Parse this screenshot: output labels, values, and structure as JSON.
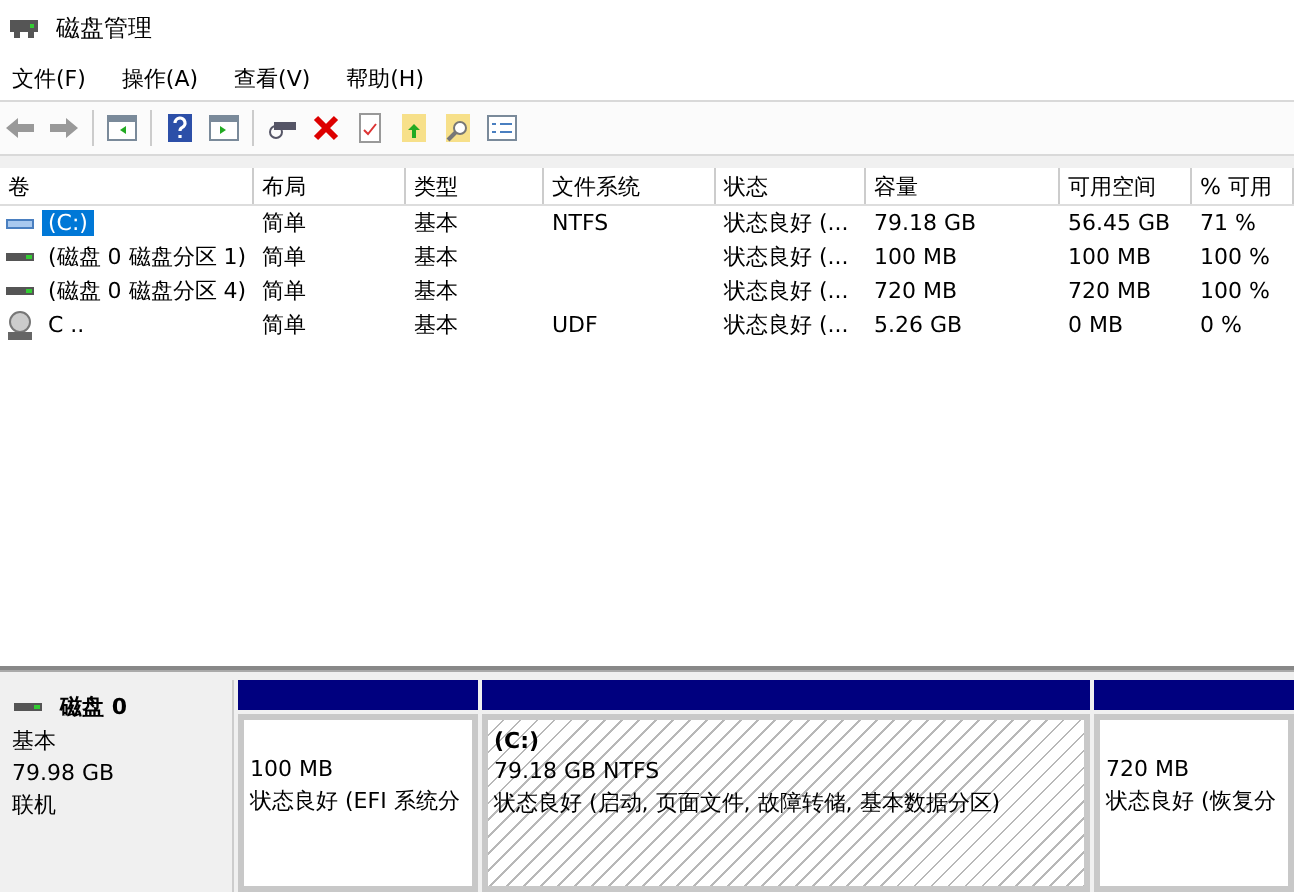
{
  "window": {
    "title": "磁盘管理"
  },
  "menu": [
    "文件(F)",
    "操作(A)",
    "查看(V)",
    "帮助(H)"
  ],
  "table": {
    "columns": [
      "卷",
      "布局",
      "类型",
      "文件系统",
      "状态",
      "容量",
      "可用空间",
      "% 可用"
    ],
    "rows": [
      {
        "kind": "disk",
        "selected": true,
        "cells": [
          "(C:)",
          "简单",
          "基本",
          "NTFS",
          "状态良好 (...",
          "79.18 GB",
          "56.45 GB",
          "71 %"
        ]
      },
      {
        "kind": "partition",
        "selected": false,
        "cells": [
          "(磁盘 0 磁盘分区 1)",
          "简单",
          "基本",
          "",
          "状态良好 (...",
          "100 MB",
          "100 MB",
          "100 %"
        ]
      },
      {
        "kind": "partition",
        "selected": false,
        "cells": [
          "(磁盘 0 磁盘分区 4)",
          "简单",
          "基本",
          "",
          "状态良好 (...",
          "720 MB",
          "720 MB",
          "100 %"
        ]
      },
      {
        "kind": "cdrom",
        "selected": false,
        "cells": [
          "C ..",
          "简单",
          "基本",
          "UDF",
          "状态良好 (...",
          "5.26 GB",
          "0 MB",
          "0 %"
        ]
      }
    ]
  },
  "disk": {
    "name": "磁盘 0",
    "type": "基本",
    "size": "79.98 GB",
    "status": "联机",
    "partitions": [
      {
        "selected": false,
        "size": "100 MB",
        "status": "状态良好 (EFI 系统分"
      },
      {
        "selected": true,
        "label": "(C:)",
        "size": "79.18 GB NTFS",
        "status": "状态良好 (启动, 页面文件, 故障转储, 基本数据分区)"
      },
      {
        "selected": false,
        "size": "720 MB",
        "status": "状态良好 (恢复分"
      }
    ]
  }
}
